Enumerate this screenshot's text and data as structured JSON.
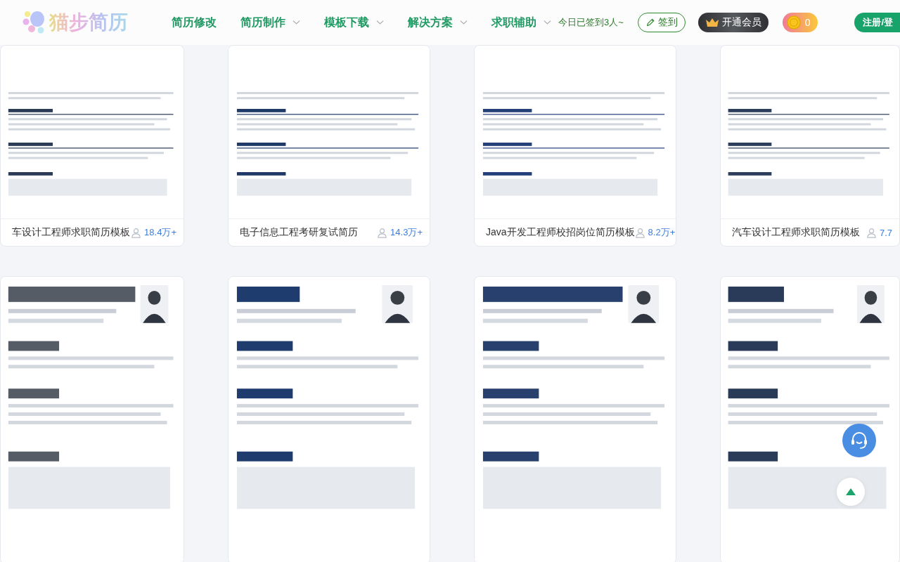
{
  "header": {
    "logo": "猫步简历",
    "nav": [
      {
        "label": "简历修改",
        "dropdown": false
      },
      {
        "label": "简历制作",
        "dropdown": true
      },
      {
        "label": "模板下载",
        "dropdown": true
      },
      {
        "label": "解决方案",
        "dropdown": true
      },
      {
        "label": "求职辅助",
        "dropdown": true
      }
    ],
    "checkin_note": "今日已签到3人~",
    "checkin_button": "签到",
    "vip_button": "开通会员",
    "coins": "0",
    "register_button": "注册/登"
  },
  "templates": [
    {
      "title": "车设计工程师求职简历模板",
      "views": "18.4万+"
    },
    {
      "title": "电子信息工程考研复试简历",
      "views": "14.3万+"
    },
    {
      "title": "Java开发工程师校招岗位简历模板",
      "views": "8.2万+"
    },
    {
      "title": "汽车设计工程师求职简历模板",
      "views": "7.7"
    },
    {
      "kind": "picture"
    },
    {
      "kind": "picture"
    },
    {
      "kind": "picture"
    },
    {
      "kind": "picture"
    }
  ]
}
